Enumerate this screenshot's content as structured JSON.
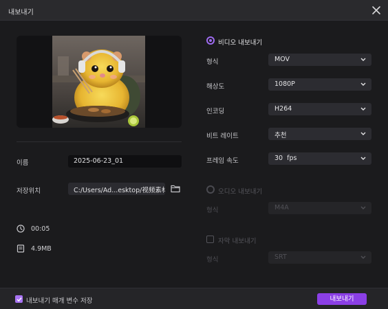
{
  "window": {
    "title": "내보내기"
  },
  "video_info": {
    "name_label": "이름",
    "name_value": "2025-06-23_01",
    "save_label": "저장위치",
    "save_path": "C:/Users/Ad...esktop/视频素材",
    "duration": "00:05",
    "size": "4.9MB"
  },
  "video_export": {
    "title": "비디오 내보내기",
    "rows": [
      {
        "label": "형식",
        "value": "MOV"
      },
      {
        "label": "해상도",
        "value": "1080P"
      },
      {
        "label": "인코딩",
        "value": "H264"
      },
      {
        "label": "비트 레이트",
        "value": "추천"
      },
      {
        "label": "프레임 속도",
        "value": "30  fps"
      }
    ]
  },
  "audio_export": {
    "title": "오디오 내보내기",
    "format_label": "형식",
    "format_value": "M4A"
  },
  "subtitle_export": {
    "title": "자막 내보내기",
    "format_label": "형식",
    "format_value": "SRT"
  },
  "footer": {
    "remember_label": "내보내기 매개 변수 저장",
    "export_button": "내보내기"
  },
  "colors": {
    "accent": "#8b3fe6",
    "radio": "#9e6bf0",
    "background": "#1b1b1d"
  },
  "icons": {
    "close": "close-icon",
    "folder": "folder-icon",
    "clock": "clock-icon",
    "file": "file-size-icon",
    "chevron": "chevron-down-icon"
  }
}
